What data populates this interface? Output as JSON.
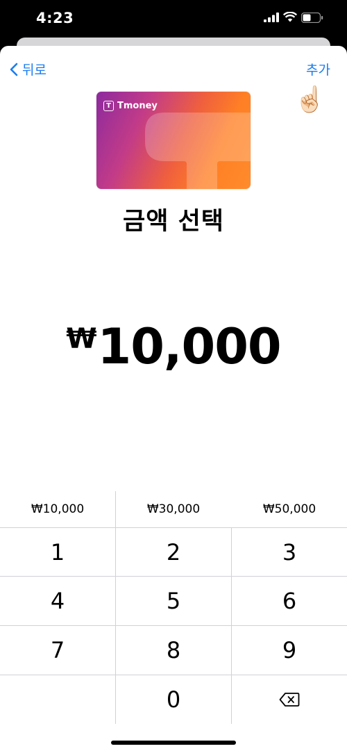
{
  "status_bar": {
    "time": "4:23"
  },
  "nav": {
    "back_label": "뒤로",
    "add_label": "추가"
  },
  "card": {
    "brand": "Tmoney",
    "logo_letter": "T"
  },
  "hand_emoji": "☝🏻",
  "title": "금액 선택",
  "amount": {
    "currency": "₩",
    "value": "10,000"
  },
  "presets": [
    "₩10,000",
    "₩30,000",
    "₩50,000"
  ],
  "keypad": [
    "1",
    "2",
    "3",
    "4",
    "5",
    "6",
    "7",
    "8",
    "9",
    "",
    "0",
    "⌫"
  ],
  "colors": {
    "accent": "#1a7cf2",
    "card_from": "#8c2a9e",
    "card_to": "#ff8c2c"
  }
}
